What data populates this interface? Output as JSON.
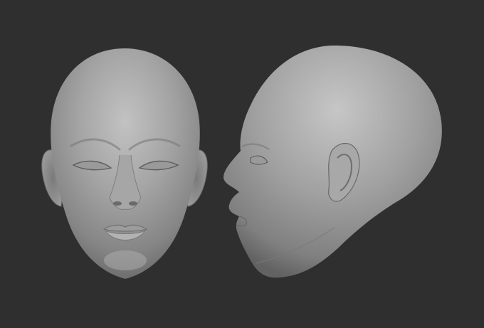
{
  "scene": {
    "background_color": "#2f2f2f",
    "model_color": "#8e8e8e",
    "views": [
      {
        "name": "front-view"
      },
      {
        "name": "side-view"
      }
    ]
  }
}
